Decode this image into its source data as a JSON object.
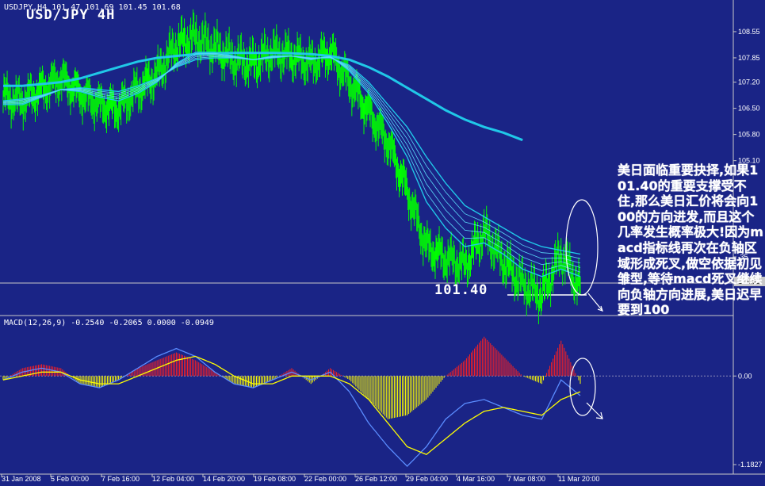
{
  "header": {
    "symbol_info": "USDJPY,H4  101.47 101.69 101.45 101.68",
    "big_title": "USD/JPY 4H",
    "macd_label": "MACD(12,26,9) -0.2540 -0.2065 0.0000 -0.0949"
  },
  "annotation": "美日面临重要抉择,如果101.40的重要支撑受不住,那么美日汇价将会向100的方向进发,而且这个几率发生概率极大!因为macd指标线再次在负轴区域形成死叉,做空依据初见雏型,等待macd死叉继续向负轴方向进展,美日迟早要到100",
  "level_label": "101.40",
  "price_tag": "101.68",
  "chart_data": [
    {
      "type": "line",
      "title": "USD/JPY 4H",
      "y_ticks": [
        "108.55",
        "107.85",
        "107.20",
        "106.50",
        "105.80",
        "105.10",
        ".35",
        "101.68"
      ],
      "x_ticks": [
        "31 Jan 2008",
        "5 Feb 00:00",
        "7 Feb 16:00",
        "12 Feb 04:00",
        "14 Feb 20:00",
        "19 Feb 08:00",
        "22 Feb 00:00",
        "26 Feb 12:00",
        "29 Feb 04:00",
        "4 Mar 16:00",
        "7 Mar 08:00",
        "11 Mar 20:00"
      ],
      "ylim": [
        101.0,
        109.1
      ],
      "x": [
        0,
        6,
        12,
        18,
        24,
        30,
        36,
        42,
        48,
        54,
        60,
        66,
        72,
        78,
        84,
        90,
        96,
        102,
        108,
        114,
        120,
        126,
        132,
        138,
        144,
        150,
        156,
        162,
        168,
        174,
        180
      ],
      "series": [
        {
          "name": "price",
          "color": "#00ff00",
          "values": [
            106.8,
            106.7,
            107.0,
            107.3,
            106.9,
            106.6,
            106.5,
            107.0,
            107.4,
            108.2,
            108.4,
            108.1,
            107.8,
            107.7,
            108.0,
            107.9,
            107.7,
            108.0,
            107.2,
            106.4,
            105.6,
            104.3,
            102.8,
            102.5,
            102.3,
            103.2,
            102.4,
            101.8,
            101.5,
            102.6,
            101.68
          ]
        },
        {
          "name": "ma_slow",
          "color": "#20c8e8",
          "values": [
            107.1,
            107.1,
            107.15,
            107.2,
            107.3,
            107.45,
            107.6,
            107.75,
            107.85,
            107.9,
            107.95,
            107.97,
            107.98,
            107.98,
            107.98,
            107.97,
            107.95,
            107.9,
            107.8,
            107.6,
            107.35,
            107.05,
            106.75,
            106.45,
            106.2,
            106.0,
            105.85,
            105.65
          ]
        },
        {
          "name": "ma_medium",
          "color": "#20c8e8",
          "values": [
            106.7,
            106.75,
            106.85,
            107.0,
            107.05,
            107.0,
            106.95,
            107.1,
            107.3,
            107.6,
            107.8,
            107.85,
            107.85,
            107.8,
            107.85,
            107.9,
            107.85,
            107.85,
            107.65,
            107.2,
            106.6,
            106.0,
            105.2,
            104.5,
            103.9,
            103.6,
            103.3,
            103.0,
            102.8,
            102.7,
            102.6
          ]
        },
        {
          "name": "ma_fast",
          "color": "#20c8e8",
          "values": [
            106.6,
            106.6,
            106.8,
            107.0,
            106.95,
            106.8,
            106.7,
            106.9,
            107.2,
            107.7,
            108.0,
            108.0,
            107.9,
            107.8,
            107.9,
            107.9,
            107.8,
            107.9,
            107.5,
            106.9,
            106.1,
            105.2,
            104.0,
            103.3,
            102.8,
            102.9,
            102.6,
            102.2,
            102.0,
            102.2,
            102.0
          ]
        }
      ]
    },
    {
      "type": "bar",
      "title": "MACD(12,26,9)",
      "y_ticks": [
        "0.00",
        "-1.1827"
      ],
      "ylim": [
        -1.25,
        0.75
      ],
      "x": [
        0,
        6,
        12,
        18,
        24,
        30,
        36,
        42,
        48,
        54,
        60,
        66,
        72,
        78,
        84,
        90,
        96,
        102,
        108,
        114,
        120,
        126,
        132,
        138,
        144,
        150,
        156,
        162,
        168,
        174,
        180
      ],
      "series": [
        {
          "name": "histogram",
          "values": [
            -0.05,
            0.1,
            0.15,
            0.1,
            -0.1,
            -0.15,
            -0.05,
            0.1,
            0.2,
            0.3,
            0.2,
            0.05,
            -0.1,
            -0.15,
            -0.05,
            0.1,
            -0.1,
            0.1,
            -0.05,
            -0.3,
            -0.55,
            -0.5,
            -0.3,
            0.0,
            0.2,
            0.5,
            0.25,
            0.0,
            -0.1,
            0.45,
            -0.1
          ]
        },
        {
          "name": "macd",
          "color": "#5a8cff",
          "values": [
            -0.05,
            0.05,
            0.1,
            0.05,
            -0.1,
            -0.15,
            -0.05,
            0.1,
            0.25,
            0.35,
            0.25,
            0.05,
            -0.1,
            -0.15,
            -0.05,
            0.05,
            -0.05,
            0.05,
            -0.2,
            -0.6,
            -0.9,
            -1.15,
            -0.9,
            -0.55,
            -0.35,
            -0.3,
            -0.4,
            -0.5,
            -0.55,
            -0.05,
            -0.25
          ]
        },
        {
          "name": "signal",
          "color": "#ffff00",
          "values": [
            -0.05,
            0.0,
            0.05,
            0.05,
            -0.05,
            -0.1,
            -0.1,
            0.0,
            0.1,
            0.2,
            0.25,
            0.15,
            0.0,
            -0.1,
            -0.1,
            0.0,
            0.0,
            0.0,
            -0.1,
            -0.3,
            -0.6,
            -0.9,
            -1.0,
            -0.8,
            -0.6,
            -0.45,
            -0.4,
            -0.45,
            -0.5,
            -0.3,
            -0.2
          ]
        }
      ]
    }
  ]
}
